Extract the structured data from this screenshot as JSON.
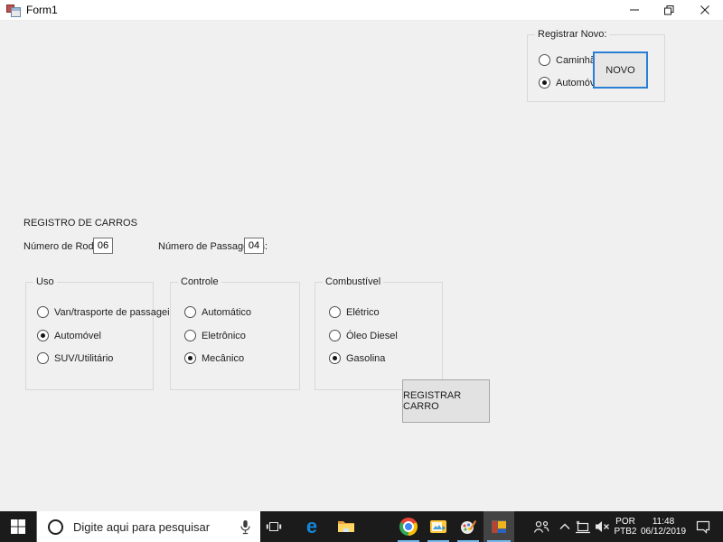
{
  "window": {
    "title": "Form1"
  },
  "register_new": {
    "title": "Registrar Novo:",
    "options": [
      {
        "label": "Caminhão",
        "selected": false
      },
      {
        "label": "Automóvel",
        "selected": true
      }
    ],
    "button": "NOVO"
  },
  "form": {
    "heading": "REGISTRO DE CARROS",
    "wheels": {
      "label": "Número de Rodas:",
      "value": "06"
    },
    "passengers": {
      "label": "Número de Passageiros:",
      "value": "04"
    },
    "groups": [
      {
        "title": "Uso",
        "options": [
          {
            "label": "Van/trasporte de passageiros",
            "selected": false
          },
          {
            "label": "Automóvel",
            "selected": true
          },
          {
            "label": "SUV/Utilitário",
            "selected": false
          }
        ]
      },
      {
        "title": "Controle",
        "options": [
          {
            "label": "Automático",
            "selected": false
          },
          {
            "label": "Eletrônico",
            "selected": false
          },
          {
            "label": "Mecânico",
            "selected": true
          }
        ]
      },
      {
        "title": "Combustível",
        "options": [
          {
            "label": "Elétrico",
            "selected": false
          },
          {
            "label": "Óleo Diesel",
            "selected": false
          },
          {
            "label": "Gasolina",
            "selected": true
          }
        ]
      }
    ],
    "register_button": "REGISTRAR CARRO"
  },
  "taskbar": {
    "search_placeholder": "Digite aqui para pesquisar",
    "edge_glyph": "e",
    "tray": {
      "lang_top": "POR",
      "lang_bottom": "PTB2",
      "time": "11:48",
      "date": "06/12/2019"
    }
  },
  "colors": {
    "accent_blue": "#0078d7",
    "running_underline": "#76b9ed",
    "taskbar_bg": "#1b1b1c",
    "form_bg": "#f0f0f0"
  }
}
